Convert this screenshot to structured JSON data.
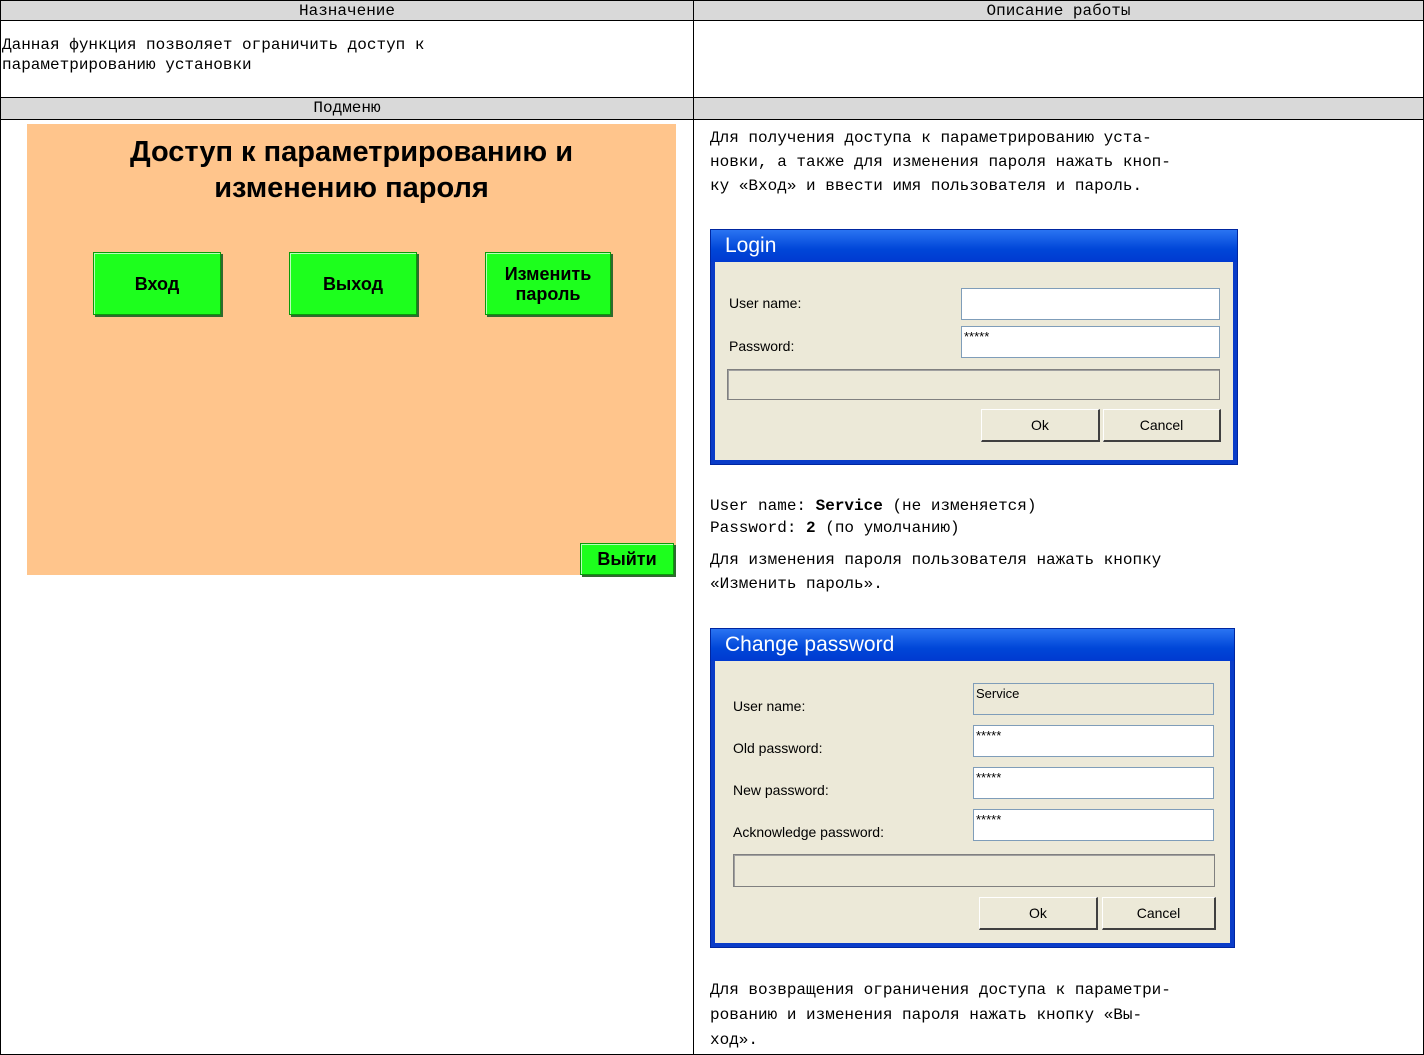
{
  "table": {
    "header_left": "Назначение",
    "header_right": "Описание работы",
    "purpose_line1": "Данная функция позволяет ограничить доступ к",
    "purpose_line2": "параметрированию установки",
    "submenu_header": "Подменю"
  },
  "panel": {
    "title_line1": "Доступ к параметрированию и",
    "title_line2": "изменению пароля",
    "btn_login": "Вход",
    "btn_logout": "Выход",
    "btn_change_line1": "Изменить",
    "btn_change_line2": "пароль",
    "btn_exit": "Выйти",
    "colors": {
      "background": "#ffc58c",
      "button": "#1dff1d"
    }
  },
  "description": {
    "p1_line1": "Для получения доступа к параметрированию уста-",
    "p1_line2": "новки, а также для изменения пароля нажать кноп-",
    "p1_line3": "ку «Вход» и ввести имя пользователя и пароль.",
    "username_label": "User name: ",
    "username_value": "Service",
    "username_note": " (не изменяется)",
    "password_label": "Password: ",
    "password_value": "2",
    "password_note": " (по умолчанию)",
    "p2_line1": "Для изменения пароля пользователя нажать кнопку",
    "p2_line2": "«Изменить пароль».",
    "p3_line1": "Для возвращения ограничения доступа к параметри-",
    "p3_line2": "рованию и изменения пароля нажать кнопку «Вы-",
    "p3_line3": "ход»."
  },
  "login_dialog": {
    "title": "Login",
    "username_label": "User name:",
    "username_value": "",
    "password_label": "Password:",
    "password_value": "*****",
    "ok": "Ok",
    "cancel": "Cancel"
  },
  "change_dialog": {
    "title": "Change password",
    "username_label": "User name:",
    "username_value": "Service",
    "old_label": "Old password:",
    "old_value": "*****",
    "new_label": "New password:",
    "new_value": "*****",
    "ack_label": "Acknowledge password:",
    "ack_value": "*****",
    "ok": "Ok",
    "cancel": "Cancel"
  }
}
